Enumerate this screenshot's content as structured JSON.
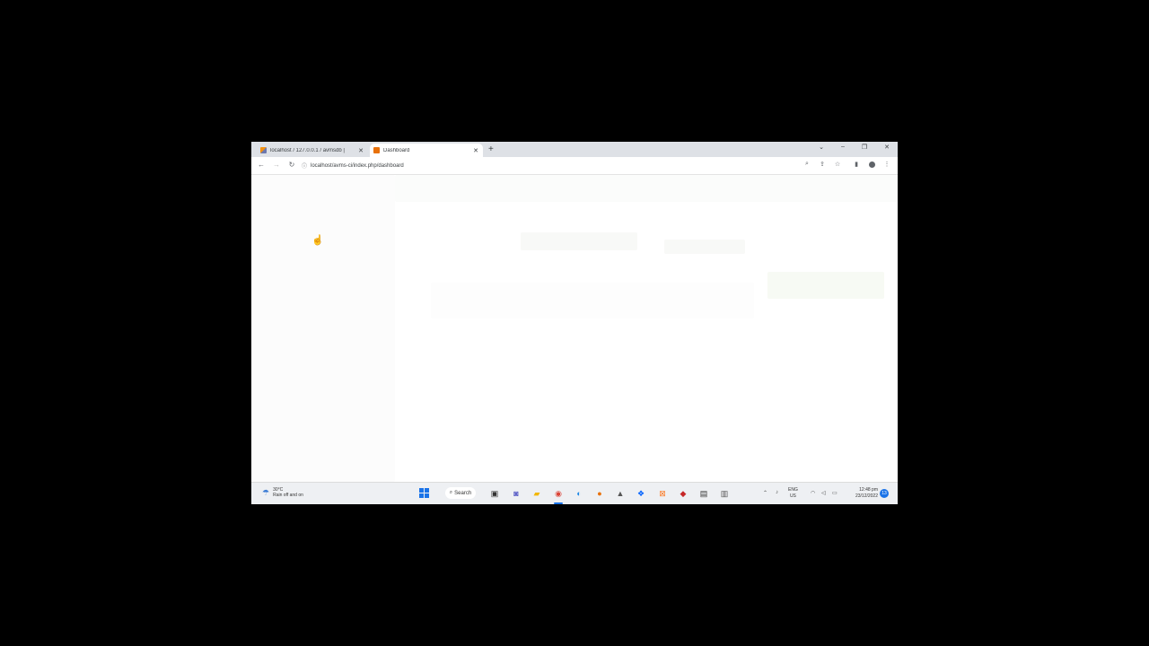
{
  "browser": {
    "tabs": [
      {
        "title": "localhost / 127.0.0.1 / avmsdb | ",
        "favicon": "phpmyadmin-icon",
        "active": false
      },
      {
        "title": "Dashboard",
        "favicon": "dashboard-favicon",
        "active": true
      }
    ],
    "new_tab": "+",
    "address": "localhost/avms-ci/index.php/dashboard"
  },
  "taskbar": {
    "weather_temp": "30°C",
    "weather_desc": "Rain off and on",
    "search_label": "Search",
    "lang_top": "ENG",
    "lang_bottom": "US",
    "time": "12:48 pm",
    "date": "23/12/2022",
    "notifications": "13"
  }
}
